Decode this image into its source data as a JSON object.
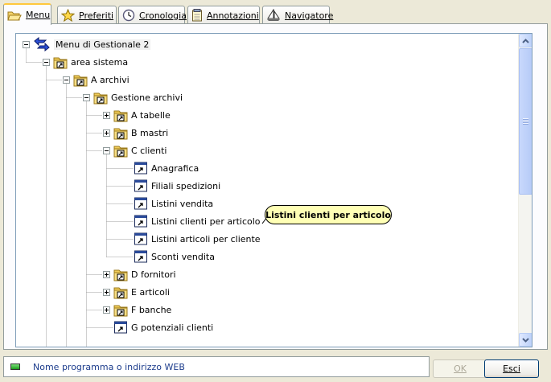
{
  "tabs": [
    {
      "label": "Menu",
      "icon": "folder-open-icon",
      "active": true
    },
    {
      "label": "Preferiti",
      "icon": "star-icon",
      "active": false
    },
    {
      "label": "Cronologia",
      "icon": "clock-icon",
      "active": false
    },
    {
      "label": "Annotazioni",
      "icon": "notepad-icon",
      "active": false
    },
    {
      "label": "Navigatore",
      "icon": "sailboat-icon",
      "active": false
    }
  ],
  "tree": {
    "root": "Menu di Gestionale 2",
    "nodes": [
      {
        "label": "area sistema",
        "type": "folder",
        "state": "expanded",
        "depth": 1
      },
      {
        "label": "A archivi",
        "type": "folder",
        "state": "expanded",
        "depth": 2
      },
      {
        "label": "Gestione archivi",
        "type": "folder",
        "state": "expanded",
        "depth": 3
      },
      {
        "label": "A tabelle",
        "type": "folder",
        "state": "collapsed",
        "depth": 4
      },
      {
        "label": "B mastri",
        "type": "folder",
        "state": "collapsed",
        "depth": 4
      },
      {
        "label": "C clienti",
        "type": "folder",
        "state": "expanded",
        "depth": 4
      },
      {
        "label": "Anagrafica",
        "type": "program",
        "depth": 5
      },
      {
        "label": "Filiali spedizioni",
        "type": "program",
        "depth": 5
      },
      {
        "label": "Listini vendita",
        "type": "program",
        "depth": 5
      },
      {
        "label": "Listini clienti per articolo",
        "type": "program",
        "depth": 5
      },
      {
        "label": "Listini articoli per cliente",
        "type": "program",
        "depth": 5
      },
      {
        "label": "Sconti vendita",
        "type": "program",
        "depth": 5
      },
      {
        "label": "D fornitori",
        "type": "folder",
        "state": "collapsed",
        "depth": 4
      },
      {
        "label": "E articoli",
        "type": "folder",
        "state": "collapsed",
        "depth": 4
      },
      {
        "label": "F banche",
        "type": "folder",
        "state": "collapsed",
        "depth": 4
      },
      {
        "label": "G potenziali clienti",
        "type": "program",
        "depth": 4
      }
    ]
  },
  "tooltip": {
    "text": "Listini clienti per articolo"
  },
  "status": {
    "text": "Nome programma o indirizzo WEB"
  },
  "buttons": {
    "ok": "OK",
    "exit": "Esci"
  },
  "colors": {
    "window": "#ece9d8",
    "tab_highlight": "#ffc83c",
    "tooltip": "#ffffb5",
    "status_text": "#1c3c8c"
  }
}
